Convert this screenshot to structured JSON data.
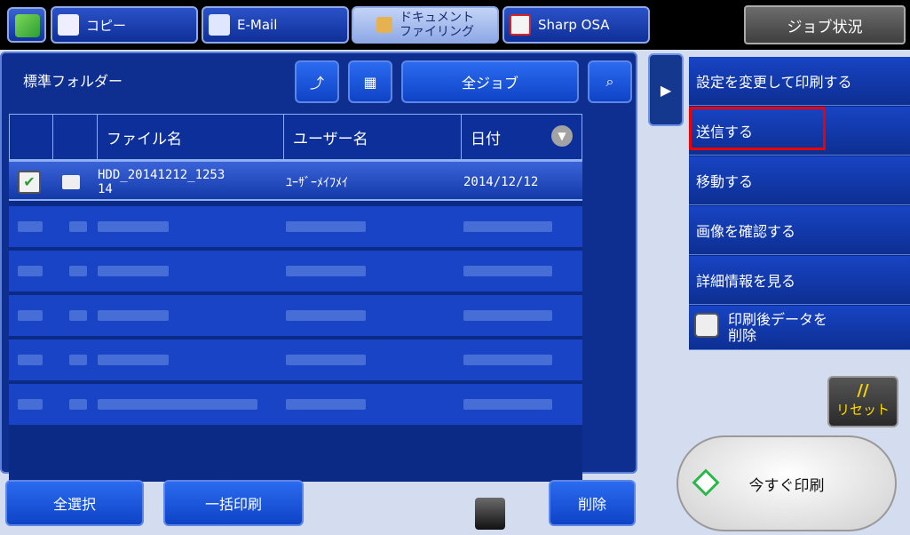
{
  "topbar": {
    "tabs": [
      {
        "label": "コピー"
      },
      {
        "label": "E-Mail"
      },
      {
        "label": "ドキュメント\nファイリング"
      },
      {
        "label": "Sharp OSA"
      }
    ],
    "job_status_label": "ジョブ状況"
  },
  "main": {
    "folder_title": "標準フォルダー",
    "all_jobs_label": "全ジョブ",
    "columns": [
      "ファイル名",
      "ユーザー名",
      "日付"
    ],
    "selected_row": {
      "filename": "HDD_20141212_1253\n14",
      "user": "ﾕｰｻﾞｰﾒｲﾌﾒｲ",
      "date": "2014/12/12"
    }
  },
  "side_menu": {
    "items": [
      "設定を変更して印刷する",
      "送信する",
      "移動する",
      "画像を確認する",
      "詳細情報を見る"
    ],
    "delete_after_print_label": "印刷後データを\n削除"
  },
  "buttons": {
    "select_all": "全選択",
    "batch_print": "一括印刷",
    "delete": "削除",
    "reset_mark": "//",
    "reset_label": "リセット",
    "print_now": "今すぐ印刷"
  }
}
